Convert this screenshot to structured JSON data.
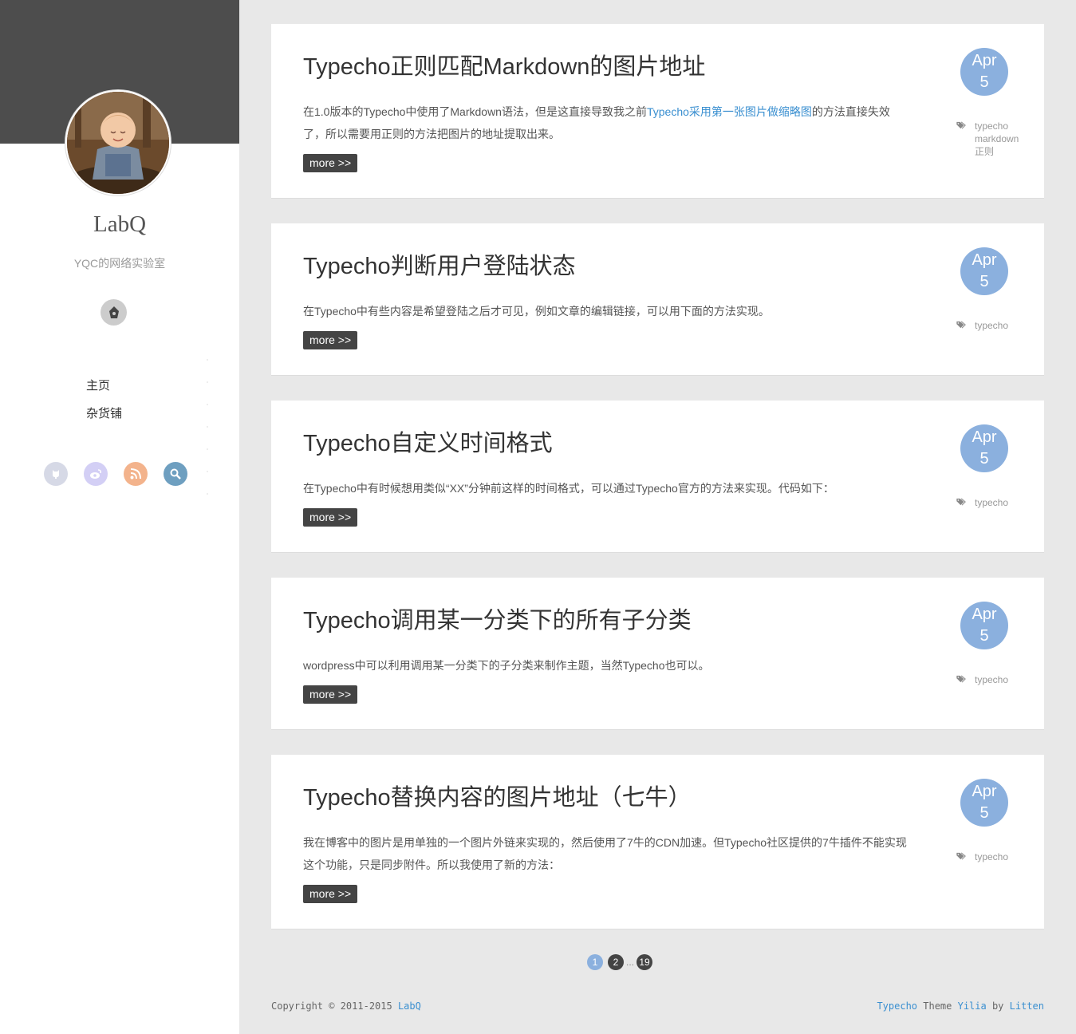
{
  "sidebar": {
    "site_name": "LabQ",
    "site_desc": "YQC的网络实验室",
    "nav": [
      "主页",
      "杂货铺"
    ],
    "social": [
      {
        "icon": "github-icon",
        "color": "#d6d9e6"
      },
      {
        "icon": "weibo-icon",
        "color": "#d3cff5"
      },
      {
        "icon": "rss-icon",
        "color": "#f3b38c"
      },
      {
        "icon": "search-icon",
        "color": "#6e9fc0"
      }
    ]
  },
  "articles": [
    {
      "title": "Typecho正则匹配Markdown的图片地址",
      "excerpt_before": "在1.0版本的Typecho中使用了Markdown语法，但是这直接导致我之前",
      "excerpt_link": "Typecho采用第一张图片做缩略图",
      "excerpt_after": "的方法直接失效了，所以需要用正则的方法把图片的地址提取出来。",
      "more": "more >>",
      "month": "Apr",
      "day": "5",
      "tags": [
        "typecho",
        "markdown",
        "正则"
      ]
    },
    {
      "title": "Typecho判断用户登陆状态",
      "excerpt_before": "在Typecho中有些内容是希望登陆之后才可见，例如文章的编辑链接，可以用下面的方法实现。",
      "more": "more >>",
      "month": "Apr",
      "day": "5",
      "tags": [
        "typecho"
      ]
    },
    {
      "title": "Typecho自定义时间格式",
      "excerpt_before": "在Typecho中有时候想用类似“XX”分钟前这样的时间格式，可以通过Typecho官方的方法来实现。代码如下：",
      "more": "more >>",
      "month": "Apr",
      "day": "5",
      "tags": [
        "typecho"
      ]
    },
    {
      "title": "Typecho调用某一分类下的所有子分类",
      "excerpt_before": "wordpress中可以利用调用某一分类下的子分类来制作主题，当然Typecho也可以。",
      "more": "more >>",
      "month": "Apr",
      "day": "5",
      "tags": [
        "typecho"
      ]
    },
    {
      "title": "Typecho替换内容的图片地址（七牛）",
      "excerpt_before": "我在博客中的图片是用单独的一个图片外链来实现的，然后使用了7牛的CDN加速。但Typecho社区提供的7牛插件不能实现这个功能，只是同步附件。所以我使用了新的方法：",
      "more": "more >>",
      "month": "Apr",
      "day": "5",
      "tags": [
        "typecho"
      ]
    }
  ],
  "pager": {
    "first": "1",
    "second": "2",
    "ellipsis": "...",
    "last": "19"
  },
  "footer": {
    "copyright": "Copyright © 2011-2015 ",
    "site_link": "LabQ",
    "cms": "Typecho",
    "theme_word": " Theme ",
    "theme": "Yilia",
    "by_word": " by ",
    "author": "Litten"
  }
}
